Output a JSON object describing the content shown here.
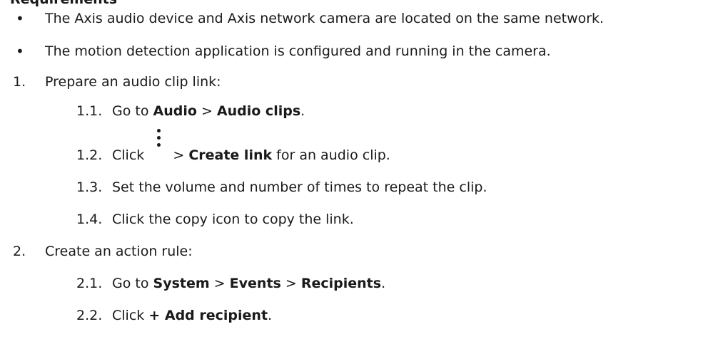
{
  "header_partial": "Requirements",
  "bullets": [
    "The Axis audio device and Axis network camera are located on the same network.",
    "The motion detection application is configured and running in the camera."
  ],
  "step1": {
    "num": "1.",
    "text": "Prepare an audio clip link:",
    "sub": [
      {
        "num": "1.1.",
        "pre": "Go to ",
        "b1": "Audio",
        "sep": " > ",
        "b2": "Audio clips",
        "post": "."
      },
      {
        "num": "1.2.",
        "pre": "Click ",
        "icon": "more-vertical-icon",
        "sep": " > ",
        "b1": "Create link",
        "post": " for an audio clip."
      },
      {
        "num": "1.3.",
        "text": "Set the volume and number of times to repeat the clip."
      },
      {
        "num": "1.4.",
        "text": "Click the copy icon to copy the link."
      }
    ]
  },
  "step2": {
    "num": "2.",
    "text": "Create an action rule:",
    "sub": [
      {
        "num": "2.1.",
        "pre": "Go to ",
        "b1": "System",
        "sep1": " > ",
        "b2": "Events",
        "sep2": " > ",
        "b3": "Recipients",
        "post": "."
      },
      {
        "num": "2.2.",
        "pre": "Click ",
        "b1": "+ Add recipient",
        "post": "."
      }
    ]
  }
}
